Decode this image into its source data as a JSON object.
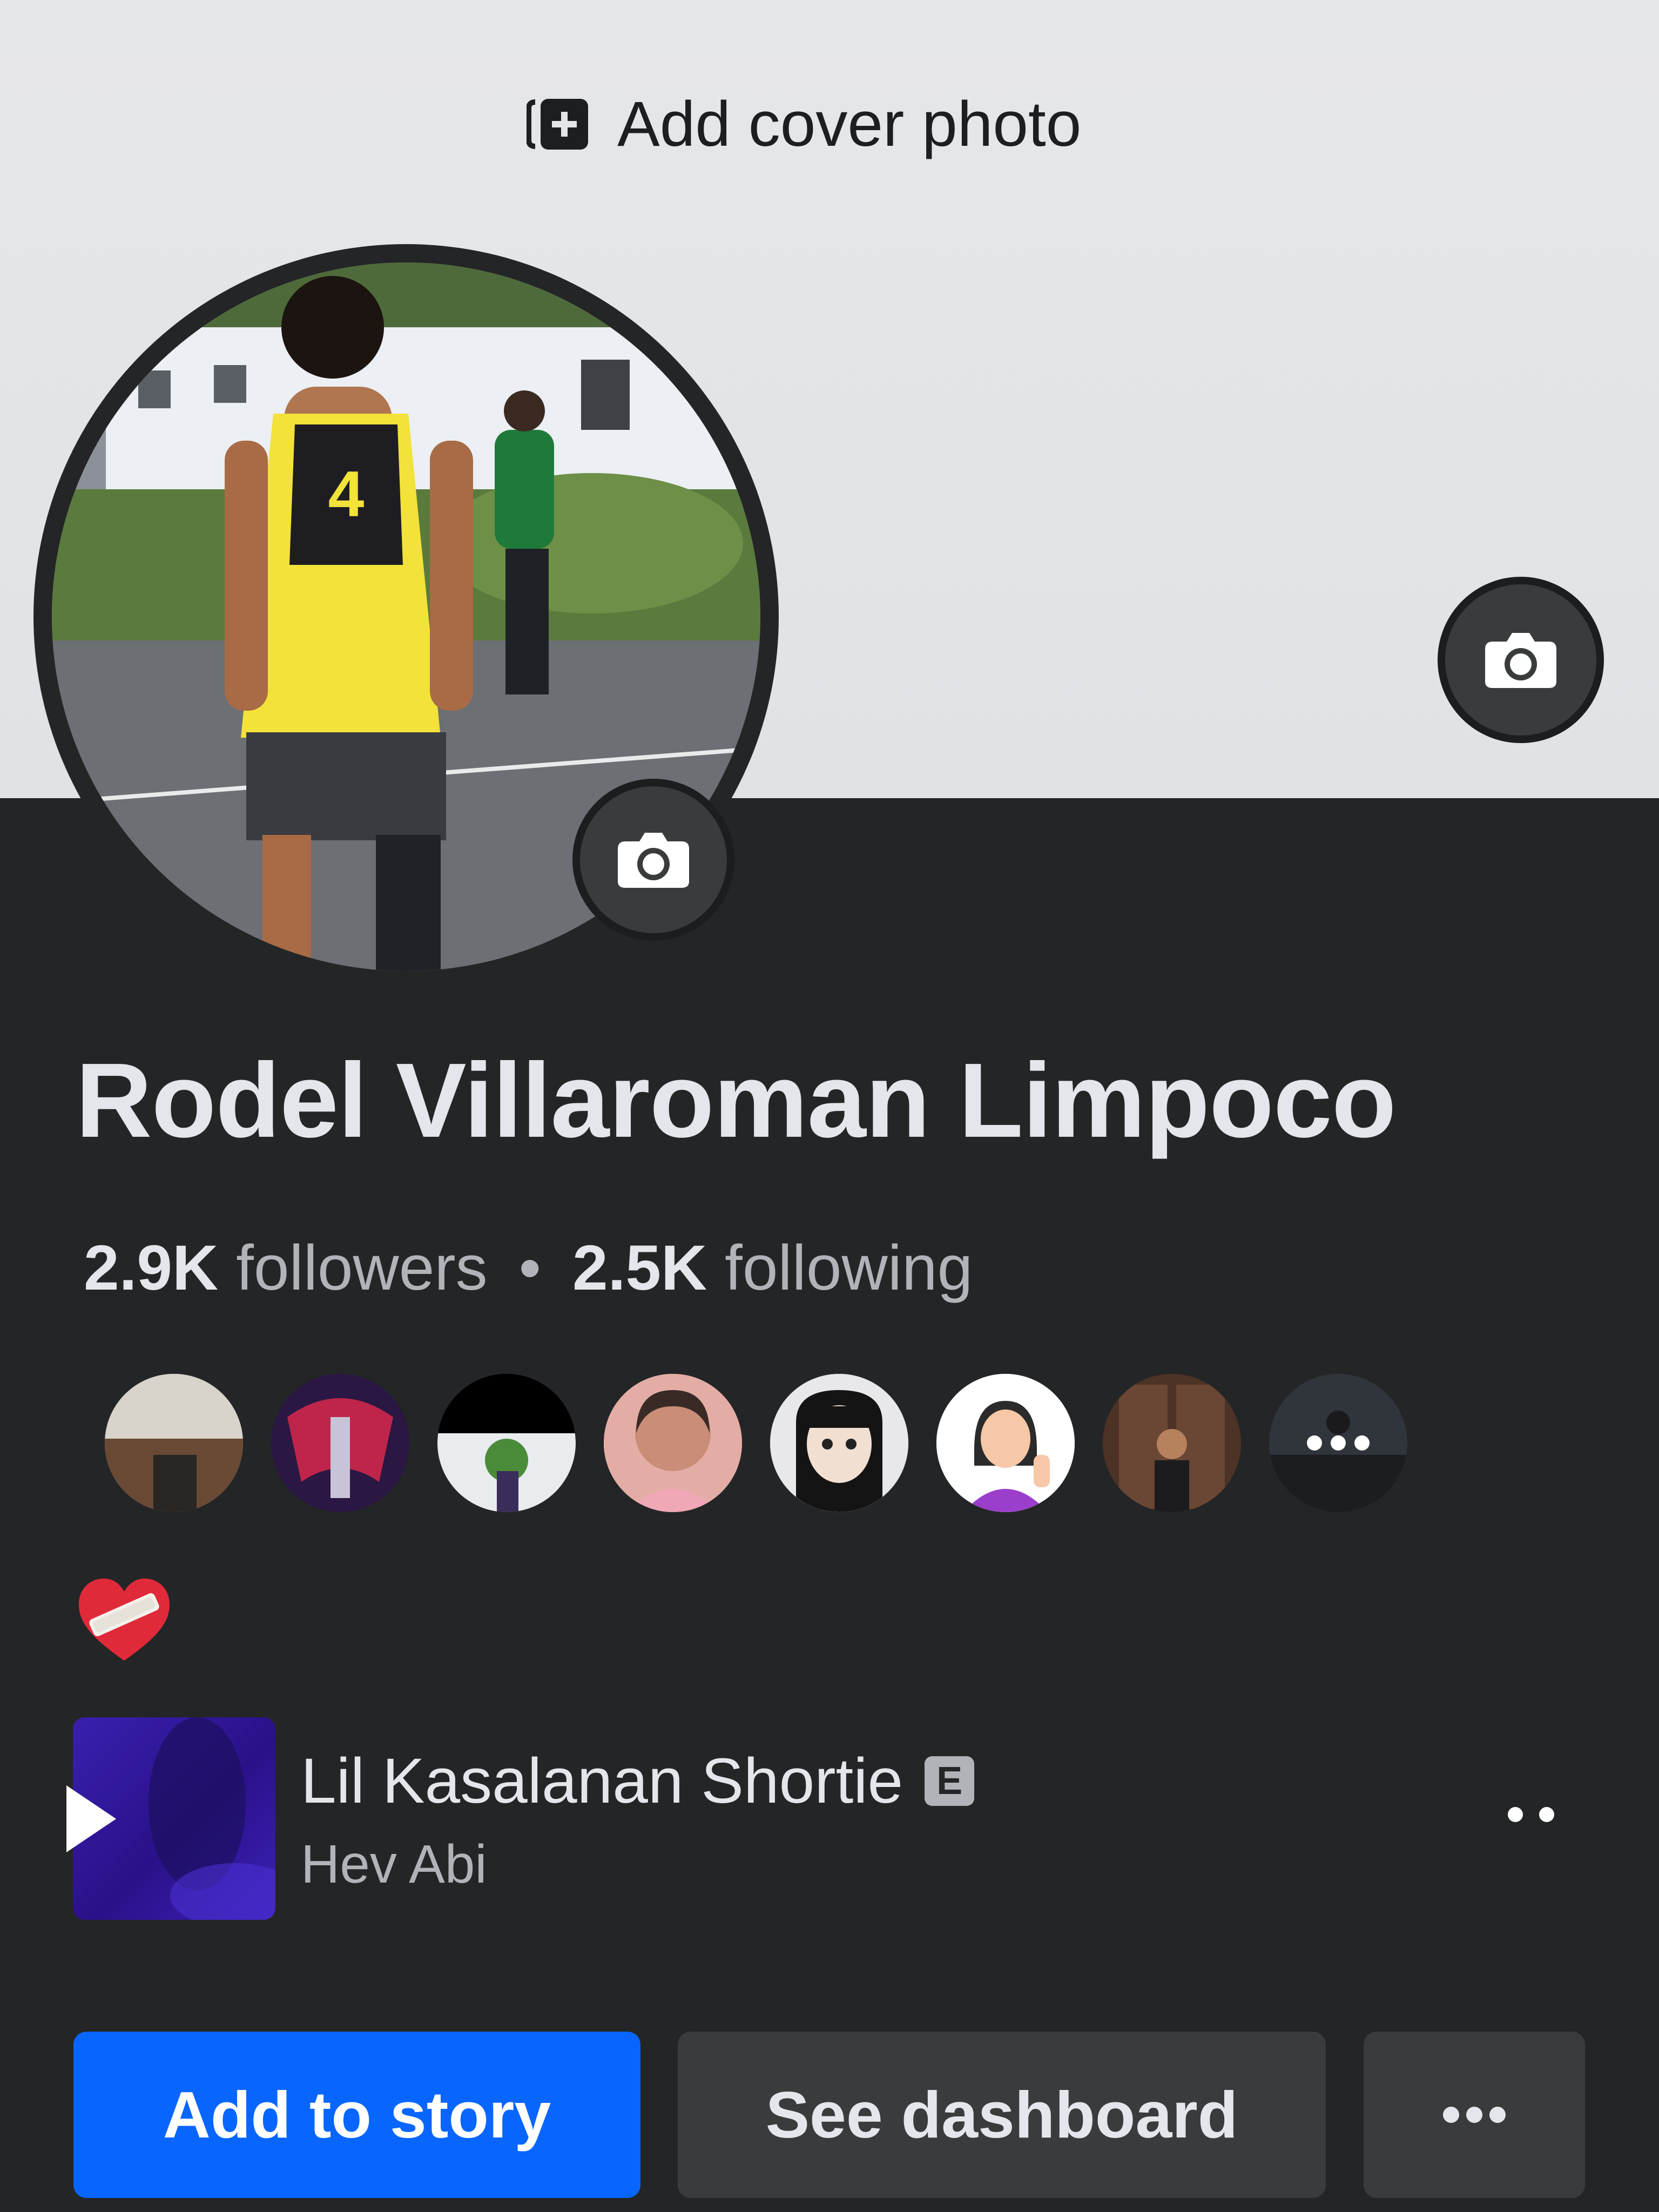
{
  "cover": {
    "add_cover_label": "Add cover photo",
    "icons": {
      "add_cover": "add-photo-icon",
      "change_cover": "camera-icon"
    }
  },
  "profile": {
    "name": "Rodel Villaroman Limpoco",
    "avatar_icon": "camera-icon",
    "followers_count": "2.9K",
    "followers_label": "followers",
    "separator": "•",
    "following_count": "2.5K",
    "following_label": "following"
  },
  "friends": {
    "count_shown": 8,
    "more_icon": "more-dots-icon"
  },
  "bio": {
    "emoji": "mending-heart-emoji"
  },
  "music": {
    "title": "Lil Kasalanan Shortie",
    "explicit_badge": "E",
    "artist": "Hev Abi",
    "play_icon": "play-icon",
    "more_icon": "more-dots-icon"
  },
  "actions": {
    "add_to_story": "Add to story",
    "see_dashboard": "See dashboard",
    "more_label": "•••"
  },
  "colors": {
    "background": "#242526",
    "cover": "#e4e5e8",
    "primary_button": "#0866ff",
    "secondary_button": "#3a3b3c",
    "text_primary": "#e4e6eb",
    "text_secondary": "#b0b3b8"
  }
}
